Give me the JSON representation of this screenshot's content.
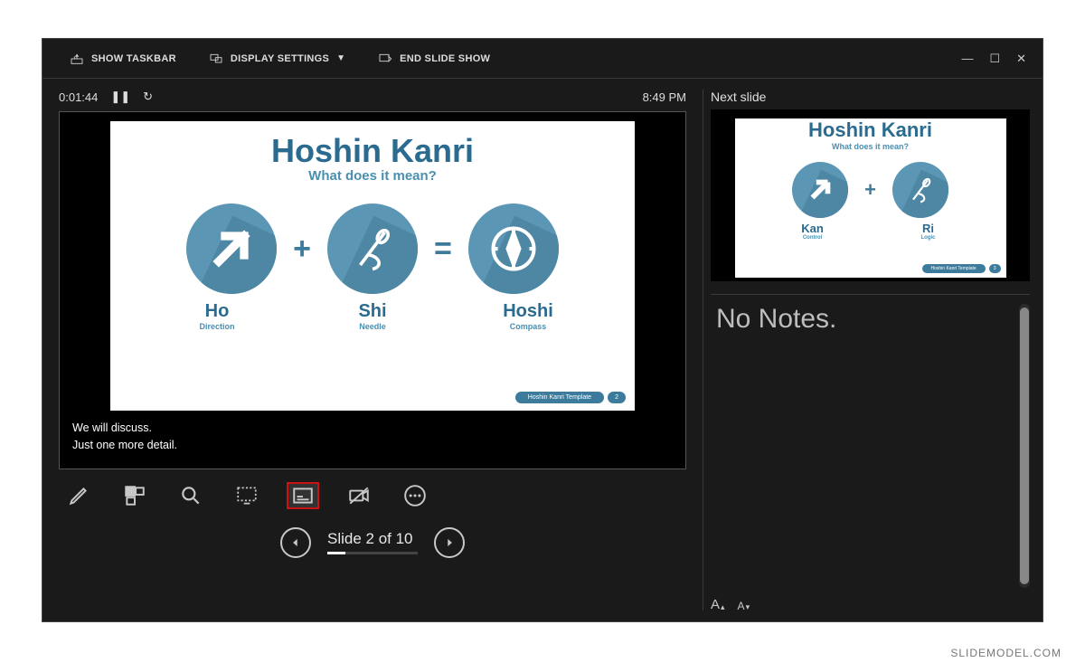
{
  "toolbar": {
    "show_taskbar": "SHOW TASKBAR",
    "display_settings": "DISPLAY SETTINGS",
    "end_show": "END SLIDE SHOW"
  },
  "status": {
    "elapsed": "0:01:44",
    "clock": "8:49 PM"
  },
  "current_slide": {
    "title": "Hoshin Kanri",
    "subtitle": "What does it mean?",
    "terms": [
      {
        "name": "Ho",
        "sub": "Direction"
      },
      {
        "name": "Shi",
        "sub": "Needle"
      },
      {
        "name": "Hoshi",
        "sub": "Compass"
      }
    ],
    "badge_text": "Hoshin Kanri Template",
    "badge_num": "2"
  },
  "subtitles": {
    "line1": "We will discuss.",
    "line2": "Just one more detail."
  },
  "nav": {
    "label": "Slide 2 of 10",
    "current": 2,
    "total": 10
  },
  "next_panel": {
    "label": "Next slide",
    "slide": {
      "title": "Hoshin Kanri",
      "subtitle": "What does it mean?",
      "terms": [
        {
          "name": "Kan",
          "sub": "Control"
        },
        {
          "name": "Ri",
          "sub": "Logic"
        }
      ],
      "badge_text": "Hoshin Kanri Template",
      "badge_num": "3"
    }
  },
  "notes": {
    "empty_text": "No Notes."
  },
  "watermark": "SLIDEMODEL.COM"
}
